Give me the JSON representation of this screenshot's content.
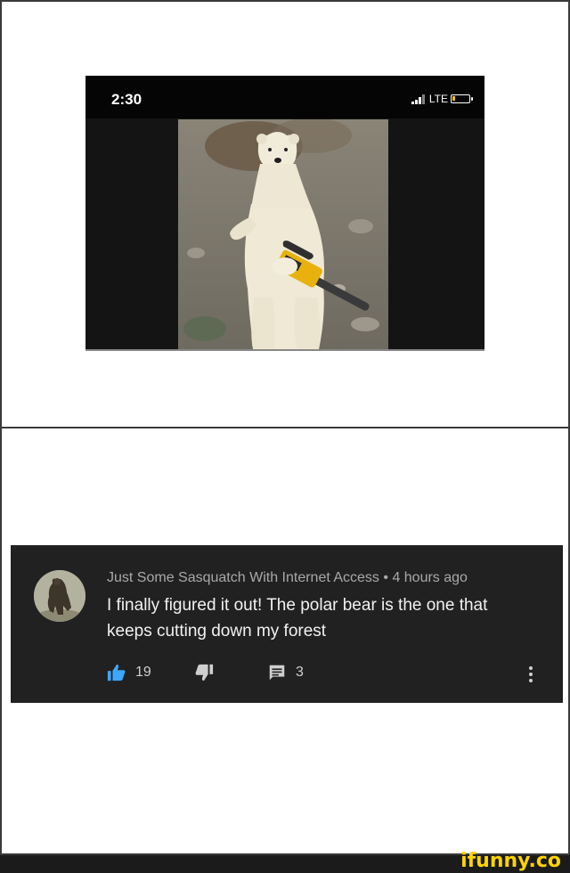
{
  "phone": {
    "time": "2:30",
    "network": "LTE"
  },
  "comment": {
    "author": "Just Some Sasquatch With Internet Access",
    "separator": "•",
    "timestamp": "4 hours ago",
    "text": "I finally figured it out! The polar bear is the one that keeps cutting down my forest",
    "likes": "19",
    "replies": "3"
  },
  "watermark": "ifunny.co",
  "colors": {
    "like_blue": "#3ea6ff",
    "card_bg": "#212121",
    "watermark_yellow": "#ffd400"
  },
  "icons": [
    "signal-icon",
    "battery-icon",
    "thumbs-up-icon",
    "thumbs-down-icon",
    "reply-icon",
    "more-options-icon"
  ]
}
